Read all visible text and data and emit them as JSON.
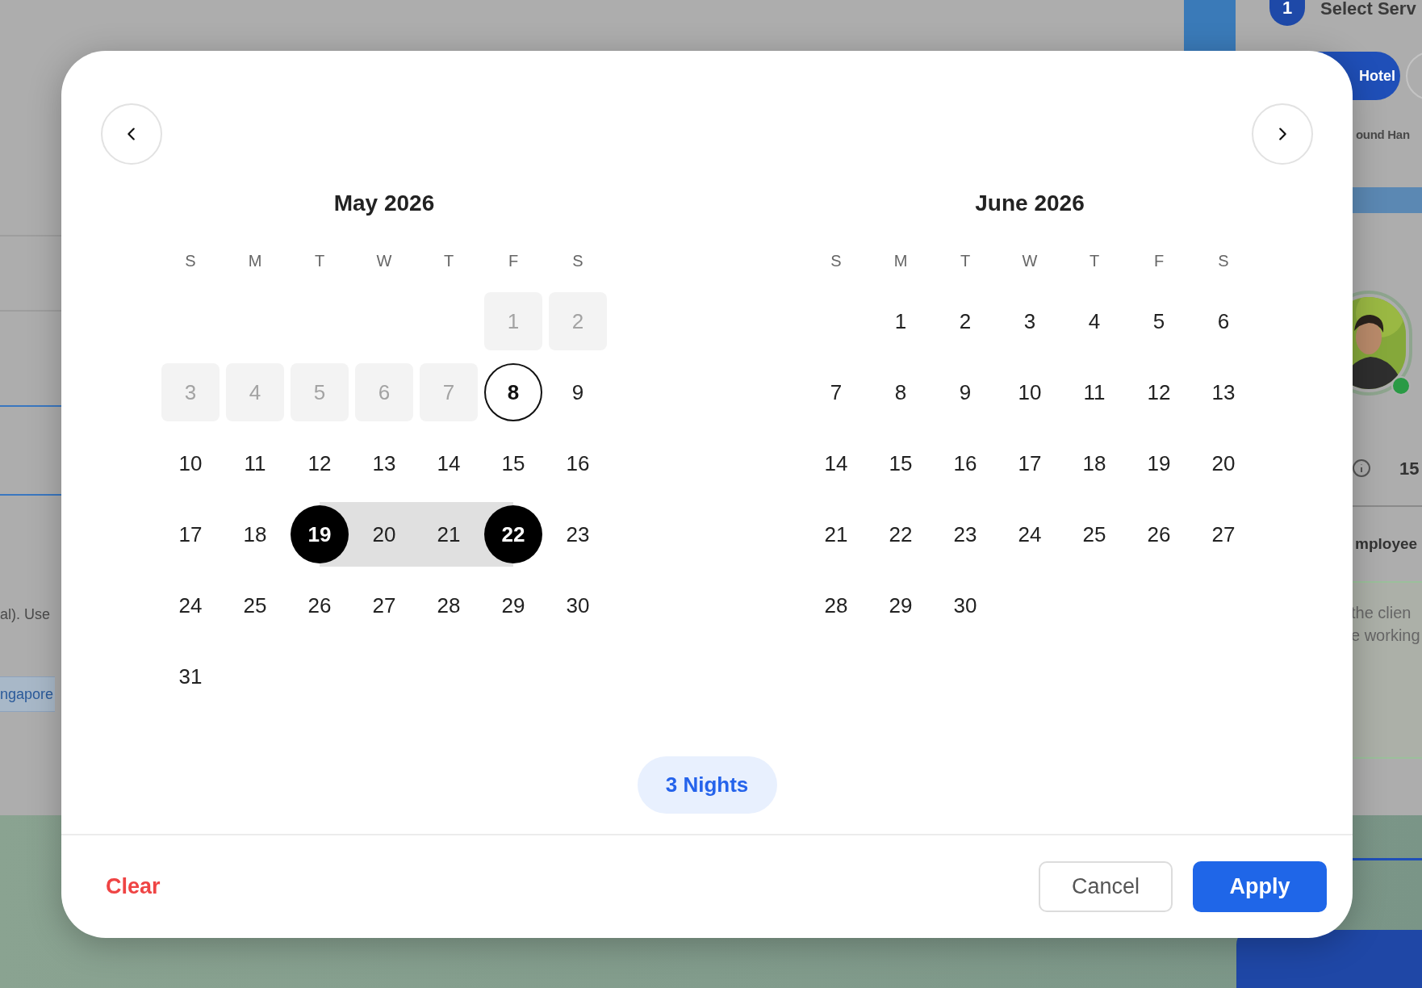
{
  "background": {
    "step_number": "1",
    "step_title": "Select Serv",
    "tab": "Hotel",
    "subtab": "ound Han",
    "value": "15",
    "section_title": "mployee",
    "description_lines": [
      "the clien",
      "e working"
    ],
    "left_text": "al). Use",
    "left_tag": "ngapore"
  },
  "calendar": {
    "months": [
      {
        "title": "May 2026",
        "weekdays": [
          "S",
          "M",
          "T",
          "W",
          "T",
          "F",
          "S"
        ],
        "weeks": [
          [
            {
              "day": "1",
              "kind": "past"
            },
            {
              "day": "2",
              "kind": "past"
            }
          ],
          [
            {
              "day": "3",
              "kind": "past"
            },
            {
              "day": "4",
              "kind": "past"
            },
            {
              "day": "5",
              "kind": "past"
            },
            {
              "day": "6",
              "kind": "past"
            },
            {
              "day": "7",
              "kind": "past"
            },
            {
              "day": "8",
              "kind": "today"
            },
            {
              "day": "9",
              "kind": "normal"
            }
          ],
          [
            {
              "day": "10",
              "kind": "normal"
            },
            {
              "day": "11",
              "kind": "normal"
            },
            {
              "day": "12",
              "kind": "normal"
            },
            {
              "day": "13",
              "kind": "normal"
            },
            {
              "day": "14",
              "kind": "normal"
            },
            {
              "day": "15",
              "kind": "normal"
            },
            {
              "day": "16",
              "kind": "normal"
            }
          ],
          [
            {
              "day": "17",
              "kind": "normal"
            },
            {
              "day": "18",
              "kind": "normal"
            },
            {
              "day": "19",
              "kind": "range_start"
            },
            {
              "day": "20",
              "kind": "range_middle"
            },
            {
              "day": "21",
              "kind": "range_middle"
            },
            {
              "day": "22",
              "kind": "range_end"
            },
            {
              "day": "23",
              "kind": "normal"
            }
          ],
          [
            {
              "day": "24",
              "kind": "normal"
            },
            {
              "day": "25",
              "kind": "normal"
            },
            {
              "day": "26",
              "kind": "normal"
            },
            {
              "day": "27",
              "kind": "normal"
            },
            {
              "day": "28",
              "kind": "normal"
            },
            {
              "day": "29",
              "kind": "normal"
            },
            {
              "day": "30",
              "kind": "normal"
            }
          ],
          [
            {
              "day": "31",
              "kind": "normal"
            }
          ]
        ]
      },
      {
        "title": "June 2026",
        "weekdays": [
          "S",
          "M",
          "T",
          "W",
          "T",
          "F",
          "S"
        ],
        "weeks": [
          [
            {
              "day": "1",
              "kind": "normal"
            },
            {
              "day": "2",
              "kind": "normal"
            },
            {
              "day": "3",
              "kind": "normal"
            },
            {
              "day": "4",
              "kind": "normal"
            },
            {
              "day": "5",
              "kind": "normal"
            },
            {
              "day": "6",
              "kind": "normal"
            }
          ],
          [
            {
              "day": "7",
              "kind": "normal"
            },
            {
              "day": "8",
              "kind": "normal"
            },
            {
              "day": "9",
              "kind": "normal"
            },
            {
              "day": "10",
              "kind": "normal"
            },
            {
              "day": "11",
              "kind": "normal"
            },
            {
              "day": "12",
              "kind": "normal"
            },
            {
              "day": "13",
              "kind": "normal"
            }
          ],
          [
            {
              "day": "14",
              "kind": "normal"
            },
            {
              "day": "15",
              "kind": "normal"
            },
            {
              "day": "16",
              "kind": "normal"
            },
            {
              "day": "17",
              "kind": "normal"
            },
            {
              "day": "18",
              "kind": "normal"
            },
            {
              "day": "19",
              "kind": "normal"
            },
            {
              "day": "20",
              "kind": "normal"
            }
          ],
          [
            {
              "day": "21",
              "kind": "normal"
            },
            {
              "day": "22",
              "kind": "normal"
            },
            {
              "day": "23",
              "kind": "normal"
            },
            {
              "day": "24",
              "kind": "normal"
            },
            {
              "day": "25",
              "kind": "normal"
            },
            {
              "day": "26",
              "kind": "normal"
            },
            {
              "day": "27",
              "kind": "normal"
            }
          ],
          [
            {
              "day": "28",
              "kind": "normal"
            },
            {
              "day": "29",
              "kind": "normal"
            },
            {
              "day": "30",
              "kind": "normal"
            }
          ]
        ]
      }
    ],
    "nights_badge": "3 Nights",
    "buttons": {
      "clear": "Clear",
      "cancel": "Cancel",
      "apply": "Apply"
    }
  }
}
